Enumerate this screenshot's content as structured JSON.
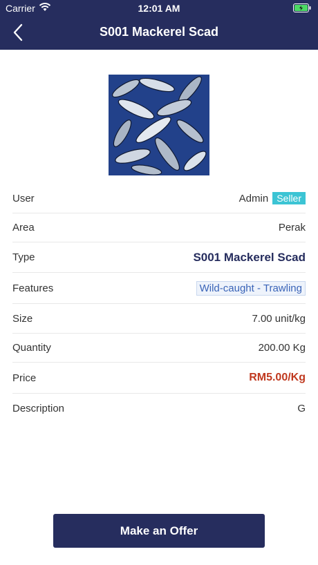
{
  "status_bar": {
    "carrier": "Carrier",
    "time": "12:01 AM"
  },
  "header": {
    "title": "S001 Mackerel Scad",
    "back_icon": "chevron-left-icon"
  },
  "details": {
    "user": {
      "label": "User",
      "value": "Admin",
      "badge": "Seller"
    },
    "area": {
      "label": "Area",
      "value": "Perak"
    },
    "type": {
      "label": "Type",
      "value": "S001 Mackerel Scad"
    },
    "features": {
      "label": "Features",
      "value": "Wild-caught - Trawling"
    },
    "size": {
      "label": "Size",
      "value": "7.00 unit/kg"
    },
    "quantity": {
      "label": "Quantity",
      "value": "200.00 Kg"
    },
    "price": {
      "label": "Price",
      "value": "RM5.00/Kg"
    },
    "description": {
      "label": "Description",
      "value": "G"
    }
  },
  "actions": {
    "offer_label": "Make an Offer"
  },
  "colors": {
    "primary": "#262d5e",
    "badge": "#3cc4d4",
    "price": "#c0391f",
    "feature_text": "#3a64b8"
  }
}
